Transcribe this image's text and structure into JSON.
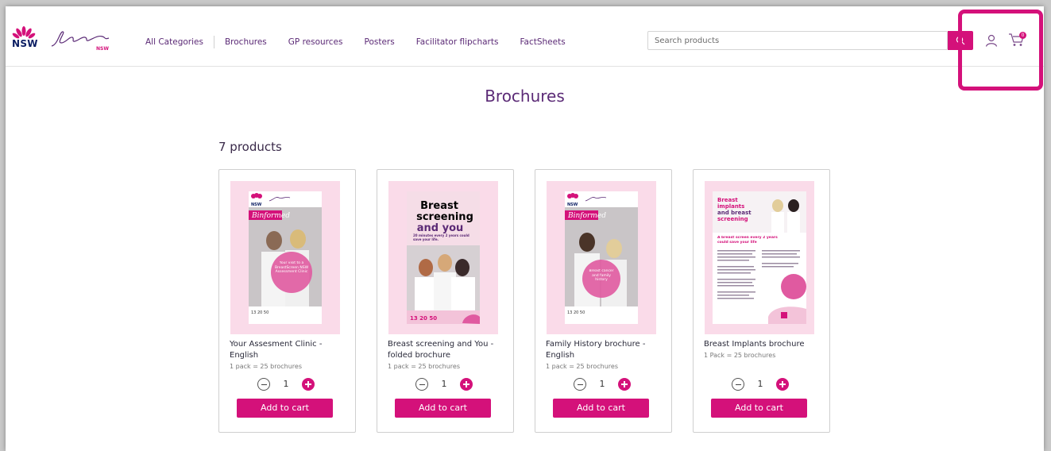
{
  "header": {
    "logo_nsw": "NSW",
    "logo_brand": "BreastScreen",
    "logo_brand_sub": "NSW",
    "nav": [
      {
        "label": "All Categories"
      },
      {
        "label": "Brochures"
      },
      {
        "label": "GP resources"
      },
      {
        "label": "Posters"
      },
      {
        "label": "Facilitator flipcharts"
      },
      {
        "label": "FactSheets"
      }
    ],
    "search_placeholder": "Search products",
    "cart_count": "0"
  },
  "page": {
    "title": "Brochures",
    "product_count": "7 products"
  },
  "products": [
    {
      "name": "Your Assesment Clinic - English",
      "desc": "1 pack = 25 brochures",
      "qty": "1",
      "add_label": "Add to cart",
      "cover": {
        "script": "Binformed",
        "circle": "Your visit to a BreastScreen NSW Assessment Clinic",
        "phone": "13 20 50"
      }
    },
    {
      "name": "Breast screening and You - folded brochure",
      "desc": "1 pack = 25 brochures",
      "qty": "1",
      "add_label": "Add to cart",
      "cover": {
        "headline_1": "Breast",
        "headline_2": "screening",
        "headline_3": "and you",
        "sub": "20 minutes every 2 years could save your life.",
        "phone": "13 20 50"
      }
    },
    {
      "name": "Family History brochure - English",
      "desc": "1 pack = 25 brochures",
      "qty": "1",
      "add_label": "Add to cart",
      "cover": {
        "script": "Binformed",
        "circle": "Breast cancer and family history",
        "phone": "13 20 50"
      }
    },
    {
      "name": "Breast Implants brochure",
      "desc": "1 Pack = 25 brochures",
      "qty": "1",
      "add_label": "Add to cart",
      "cover": {
        "headline_1": "Breast",
        "headline_2": "implants",
        "headline_3": "and breast",
        "headline_4": "screening",
        "sub": "A breast screen every 2 years could save your life"
      }
    }
  ],
  "colors": {
    "accent": "#d4117a",
    "nav_text": "#5b2a76",
    "thumb_bg": "#fadbe9"
  }
}
